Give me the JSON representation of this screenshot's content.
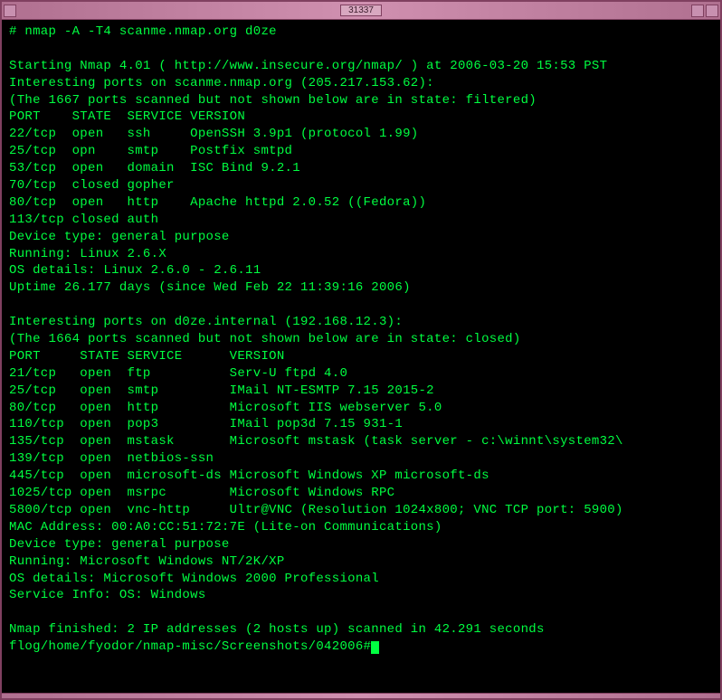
{
  "window": {
    "title": "31337"
  },
  "terminal": {
    "command": "# nmap -A -T4 scanme.nmap.org d0ze",
    "header": "Starting Nmap 4.01 ( http://www.insecure.org/nmap/ ) at 2006-03-20 15:53 PST",
    "host1": {
      "interesting": "Interesting ports on scanme.nmap.org (205.217.153.62):",
      "filtered_note": "(The 1667 ports scanned but not shown below are in state: filtered)",
      "table_header": "PORT    STATE  SERVICE VERSION",
      "rows": [
        "22/tcp  open   ssh     OpenSSH 3.9p1 (protocol 1.99)",
        "25/tcp  opn    smtp    Postfix smtpd",
        "53/tcp  open   domain  ISC Bind 9.2.1",
        "70/tcp  closed gopher",
        "80/tcp  open   http    Apache httpd 2.0.52 ((Fedora))",
        "113/tcp closed auth"
      ],
      "device_type": "Device type: general purpose",
      "running": "Running: Linux 2.6.X",
      "os_details": "OS details: Linux 2.6.0 - 2.6.11",
      "uptime": "Uptime 26.177 days (since Wed Feb 22 11:39:16 2006)"
    },
    "host2": {
      "interesting": "Interesting ports on d0ze.internal (192.168.12.3):",
      "filtered_note": "(The 1664 ports scanned but not shown below are in state: closed)",
      "table_header": "PORT     STATE SERVICE      VERSION",
      "rows": [
        "21/tcp   open  ftp          Serv-U ftpd 4.0",
        "25/tcp   open  smtp         IMail NT-ESMTP 7.15 2015-2",
        "80/tcp   open  http         Microsoft IIS webserver 5.0",
        "110/tcp  open  pop3         IMail pop3d 7.15 931-1",
        "135/tcp  open  mstask       Microsoft mstask (task server - c:\\winnt\\system32\\",
        "139/tcp  open  netbios-ssn",
        "445/tcp  open  microsoft-ds Microsoft Windows XP microsoft-ds",
        "1025/tcp open  msrpc        Microsoft Windows RPC",
        "5800/tcp open  vnc-http     Ultr@VNC (Resolution 1024x800; VNC TCP port: 5900)"
      ],
      "mac": "MAC Address: 00:A0:CC:51:72:7E (Lite-on Communications)",
      "device_type": "Device type: general purpose",
      "running": "Running: Microsoft Windows NT/2K/XP",
      "os_details": "OS details: Microsoft Windows 2000 Professional",
      "service_info": "Service Info: OS: Windows"
    },
    "finished": "Nmap finished: 2 IP addresses (2 hosts up) scanned in 42.291 seconds",
    "prompt": "flog/home/fyodor/nmap-misc/Screenshots/042006#"
  }
}
